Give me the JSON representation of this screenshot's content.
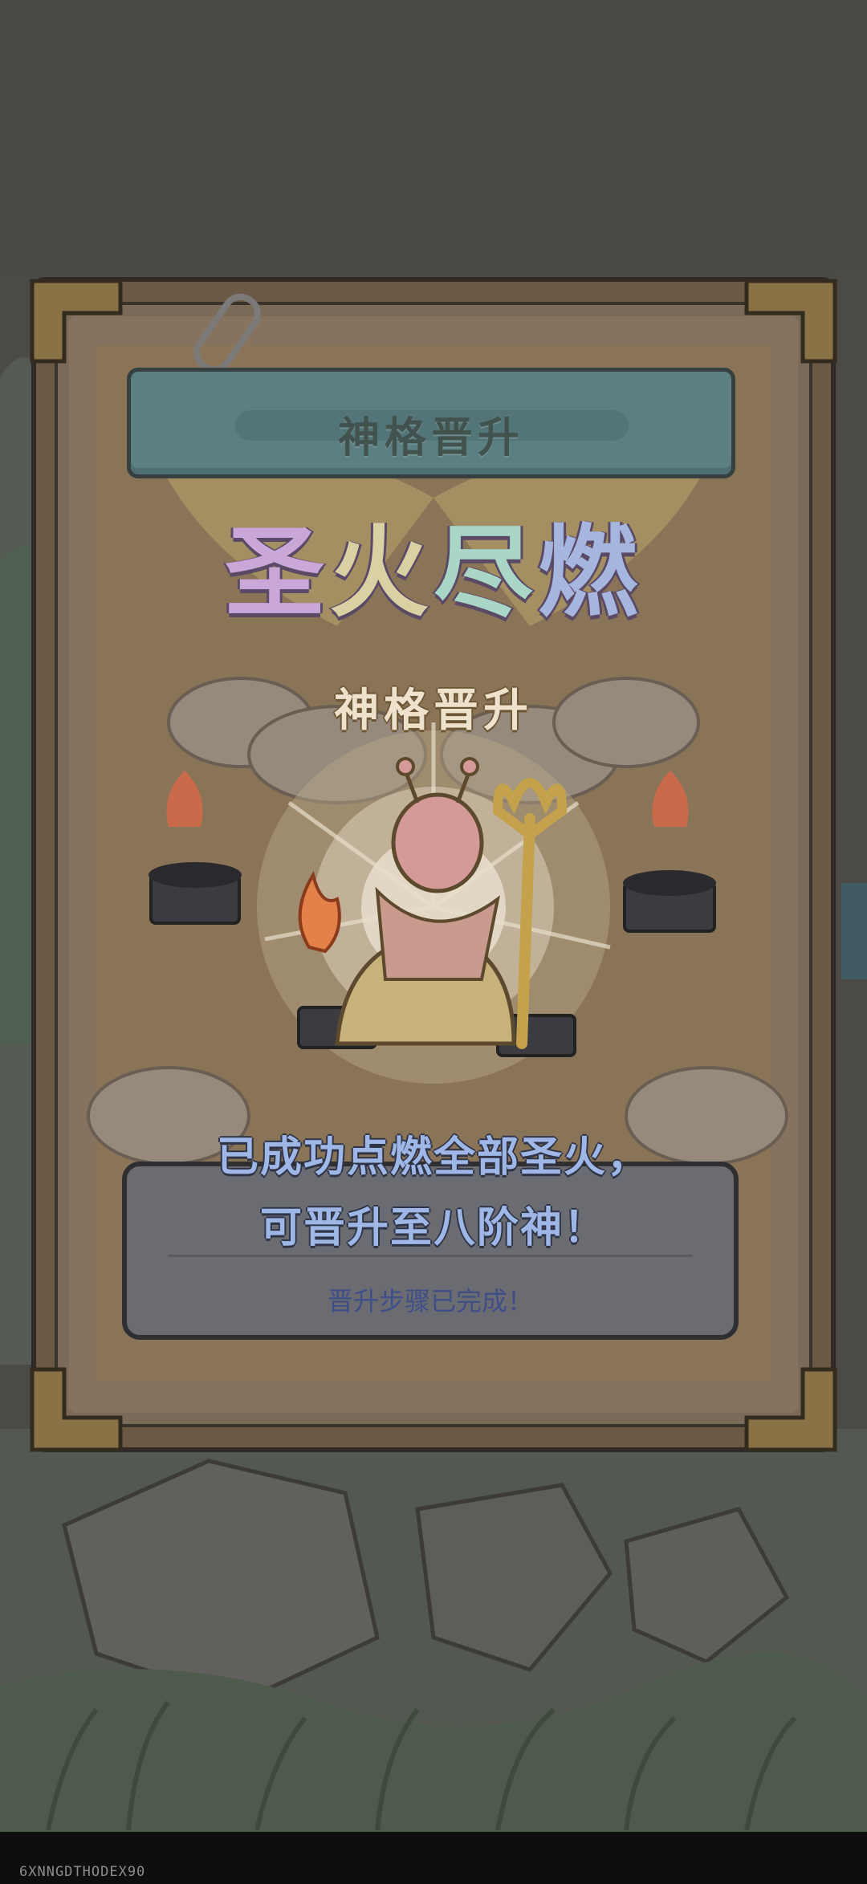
{
  "colors": {
    "background": "#4a4a46",
    "banner": "#5c7f82",
    "headline_gradient": [
      "#c9a7d8",
      "#d9d0a4",
      "#a9d6c7",
      "#a7b6df"
    ],
    "message_text": "#9fb7e6",
    "status_text": "#3f4e86"
  },
  "modal": {
    "banner_title": "神格晋升",
    "headline_chars": [
      "圣",
      "火",
      "尽",
      "燃"
    ],
    "subheadline": "神格晋升",
    "message_lines": [
      "已成功点燃全部圣火，",
      "可晋升至八阶神！"
    ],
    "status": "晋升步骤已完成！"
  },
  "icons": {
    "clip": "paperclip-icon",
    "left_brazier": "fire-brazier-icon",
    "right_brazier": "fire-brazier-icon",
    "deity": "snail-deity-icon",
    "staff": "golden-staff-icon",
    "flame": "flame-icon"
  },
  "watermark": "6XNNGDTHODEX90"
}
